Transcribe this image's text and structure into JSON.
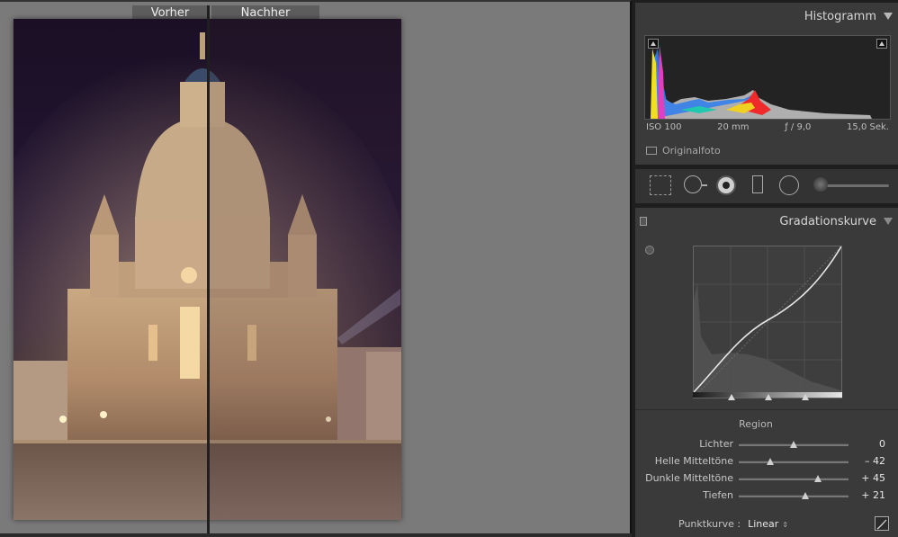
{
  "compare": {
    "before_label": "Vorher",
    "after_label": "Nachher"
  },
  "histogram": {
    "title": "Histogramm",
    "iso": "ISO 100",
    "focal": "20 mm",
    "aperture": "ƒ / 9,0",
    "shutter": "15,0 Sek.",
    "original_label": "Originalfoto"
  },
  "tone_curve": {
    "title": "Gradationskurve",
    "region_title": "Region",
    "sliders": [
      {
        "label": "Lichter",
        "value": "0",
        "amount": 0
      },
      {
        "label": "Helle Mitteltöne",
        "value": "– 42",
        "amount": -42
      },
      {
        "label": "Dunkle Mitteltöne",
        "value": "+ 45",
        "amount": 45
      },
      {
        "label": "Tiefen",
        "value": "+ 21",
        "amount": 21
      }
    ],
    "point_curve_label": "Punktkurve :",
    "point_curve_value": "Linear",
    "point_curve_arrows": "⇕"
  },
  "icons": [
    "collapse-triangle-icon",
    "crop-icon",
    "spot-removal-icon",
    "red-eye-icon",
    "graduated-filter-icon",
    "radial-filter-icon",
    "adjustment-brush-icon",
    "target-adjust-icon",
    "curve-edit-icon"
  ]
}
